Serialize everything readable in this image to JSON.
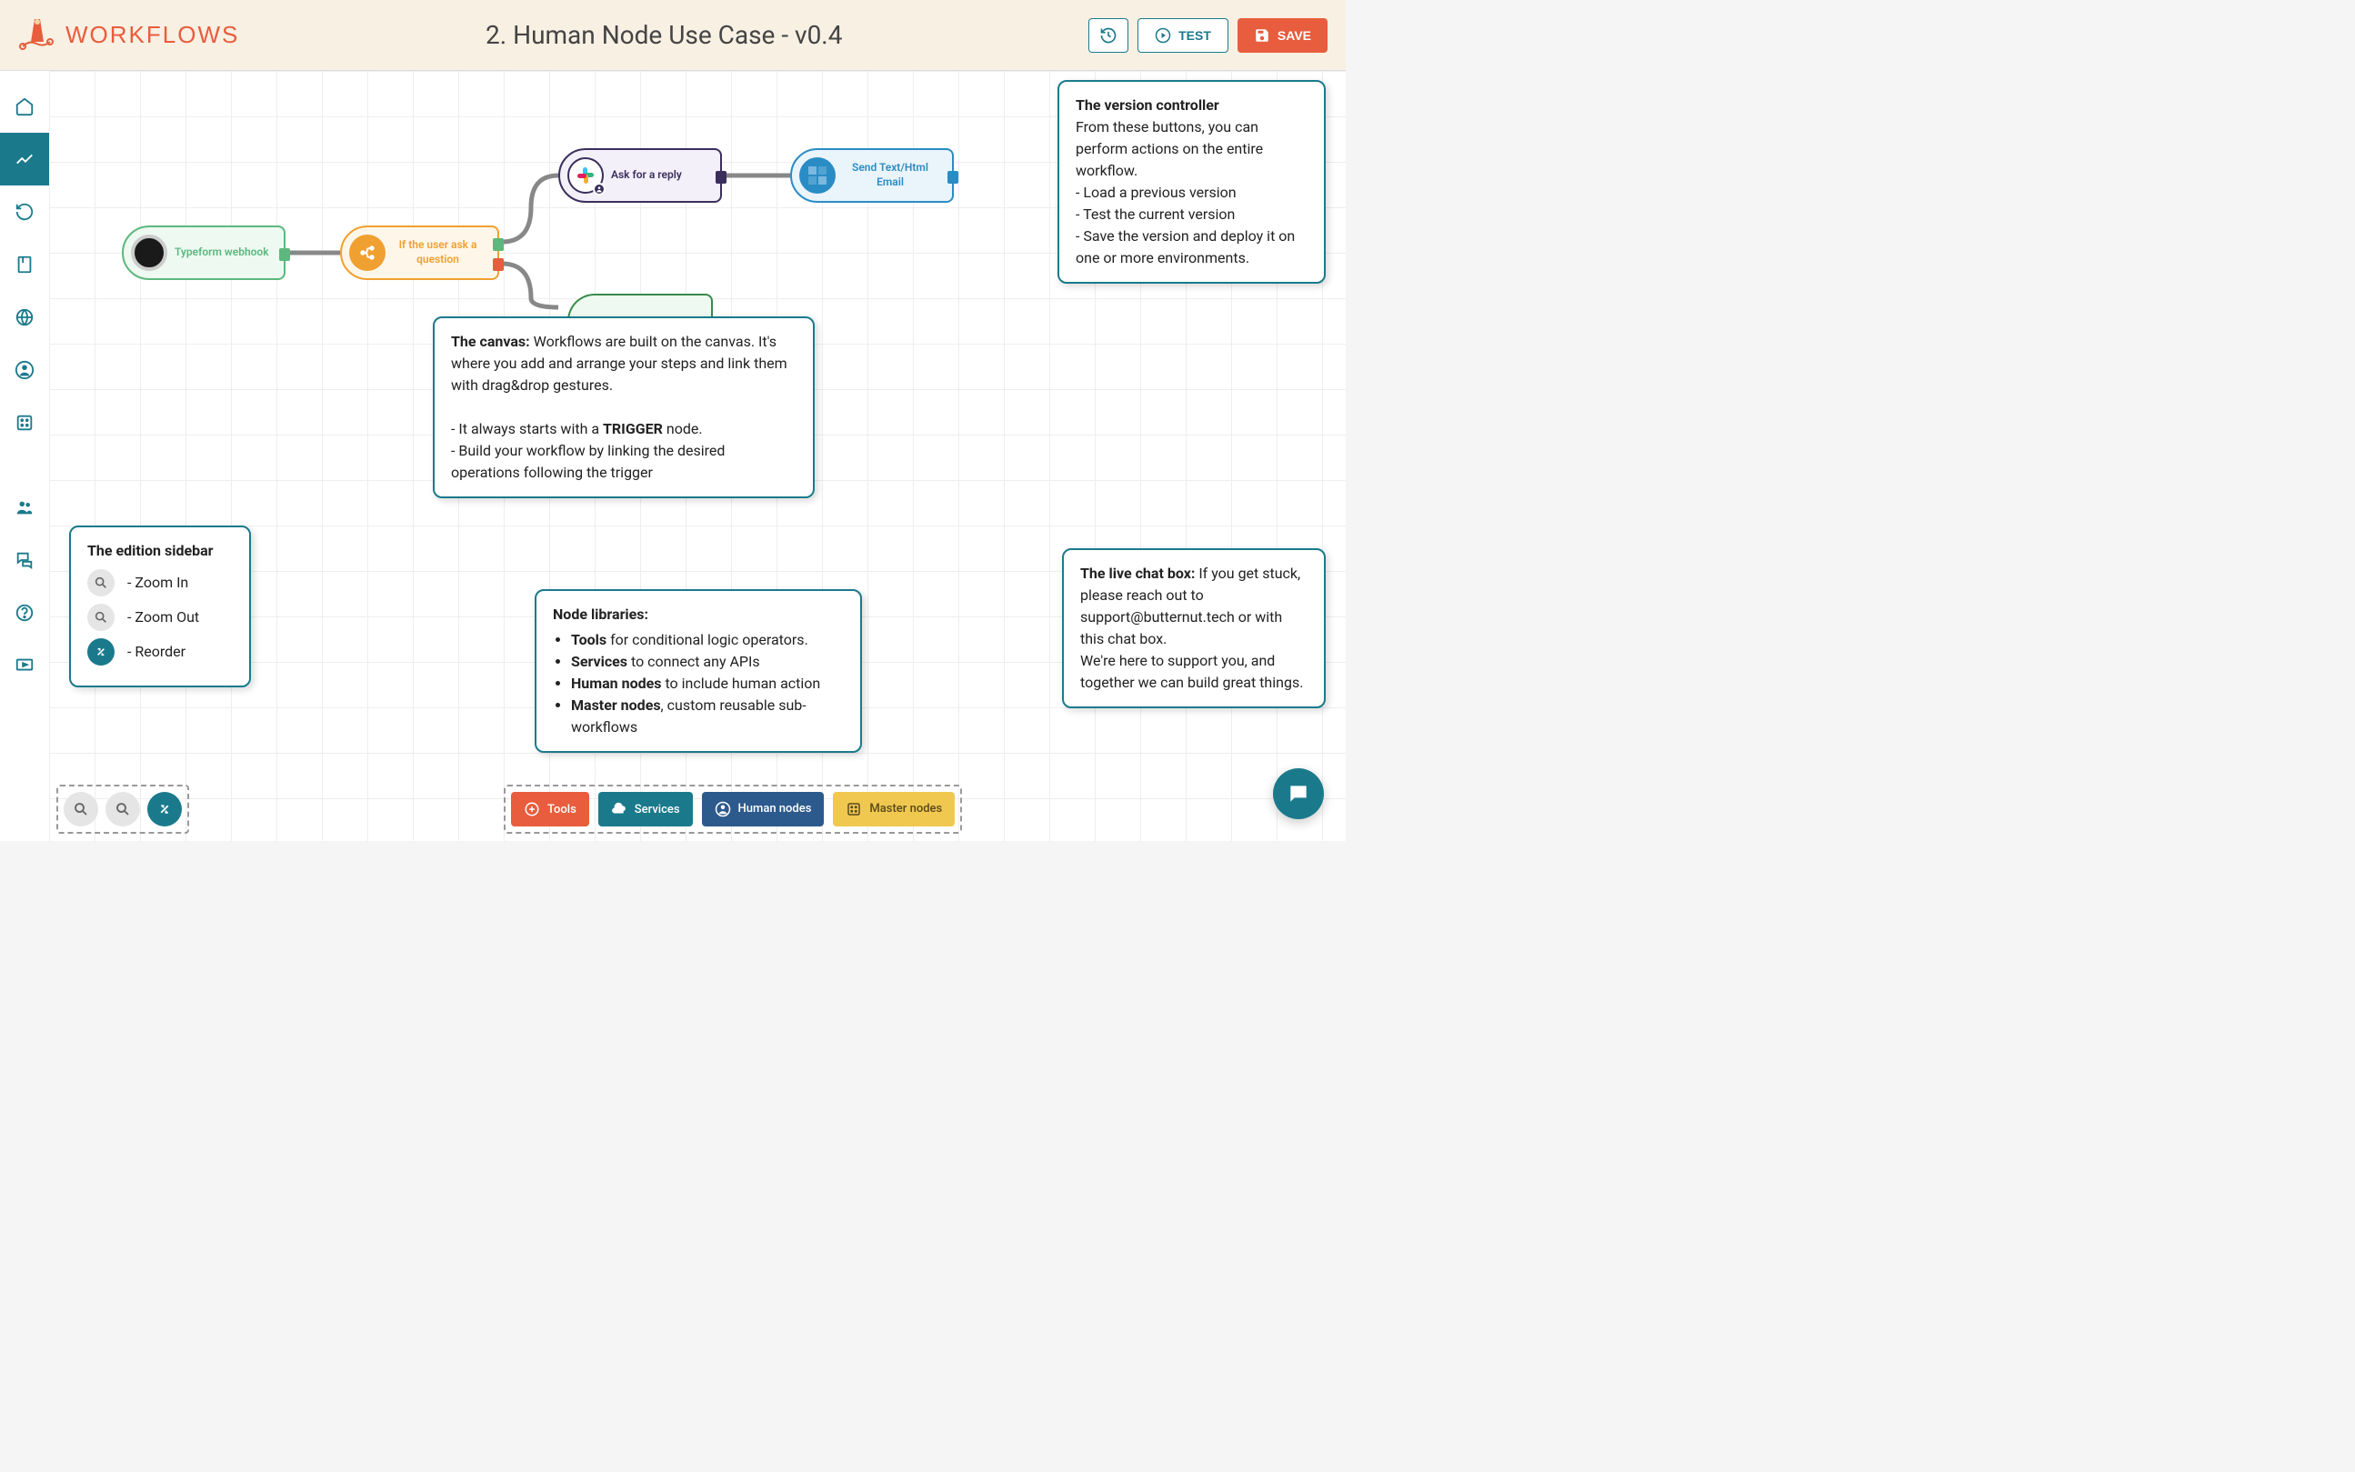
{
  "header": {
    "app_name": "WORKFLOWS",
    "workflow_title": "2. Human Node Use Case - v0.4",
    "test_label": "TEST",
    "save_label": "SAVE"
  },
  "nodes": {
    "trigger": {
      "label": "Typeform webhook"
    },
    "condition": {
      "label": "If the user ask a question"
    },
    "slack": {
      "label": "Ask for a reply"
    },
    "email": {
      "label": "Send Text/Html Email"
    }
  },
  "callouts": {
    "version": {
      "title": "The version controller",
      "body": "From these buttons, you can perform actions on the entire workflow.",
      "line1": "- Load a previous version",
      "line2": "- Test the current version",
      "line3": "- Save the version and deploy it on one or more environments."
    },
    "canvas": {
      "title": "The canvas:",
      "body": " Workflows are built on the canvas. It's where you add and arrange your steps and link them with drag&drop gestures.",
      "line1_pre": "- It always starts with a ",
      "line1_bold": "TRIGGER",
      "line1_post": " node.",
      "line2": "- Build your workflow by linking the desired operations following the trigger"
    },
    "sidebar": {
      "title": "The edition sidebar",
      "zoom_in": "- Zoom In",
      "zoom_out": "- Zoom Out",
      "reorder": "- Reorder"
    },
    "nodelib": {
      "title": "Node libraries:",
      "li1_b": "Tools",
      "li1_r": " for conditional logic operators.",
      "li2_b": "Services",
      "li2_r": " to connect any APIs",
      "li3_b": "Human nodes",
      "li3_r": " to include human action",
      "li4_b": "Master nodes",
      "li4_r": ", custom reusable sub-workflows"
    },
    "chat": {
      "title": "The live chat box:",
      "body": " If you get stuck, please reach out to support@butternut.tech or with this chat box.",
      "body2": "We're here to support you, and together we can build great things."
    }
  },
  "bottom_libs": {
    "tools": "Tools",
    "services": "Services",
    "human": "Human nodes",
    "master": "Master nodes"
  }
}
